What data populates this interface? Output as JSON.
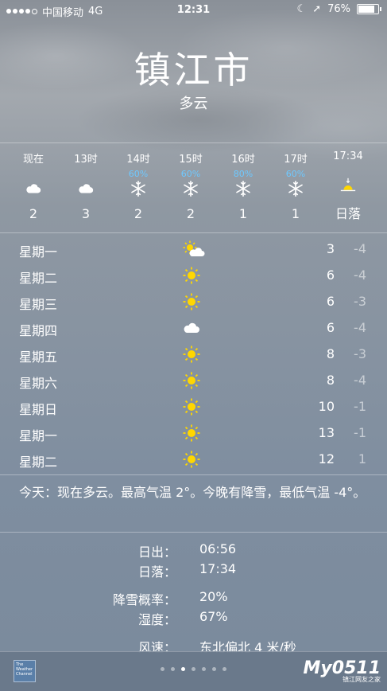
{
  "status_bar": {
    "carrier": "中国移动",
    "network": "4G",
    "time": "12:31",
    "battery": "76%"
  },
  "header": {
    "city": "镇江市",
    "condition": "多云"
  },
  "hourly": [
    {
      "label": "现在",
      "precip": "",
      "icon": "cloud-icon",
      "value": "2"
    },
    {
      "label": "13时",
      "precip": "",
      "icon": "cloud-icon",
      "value": "3"
    },
    {
      "label": "14时",
      "precip": "60%",
      "icon": "snowflake-icon",
      "value": "2"
    },
    {
      "label": "15时",
      "precip": "60%",
      "icon": "snowflake-icon",
      "value": "2"
    },
    {
      "label": "16时",
      "precip": "80%",
      "icon": "snowflake-icon",
      "value": "1"
    },
    {
      "label": "17时",
      "precip": "60%",
      "icon": "snowflake-icon",
      "value": "1"
    },
    {
      "label": "17:34",
      "precip": "",
      "icon": "sunset-icon",
      "value": "日落"
    }
  ],
  "daily": [
    {
      "day": "星期一",
      "icon": "partly-sunny-icon",
      "high": "3",
      "low": "-4"
    },
    {
      "day": "星期二",
      "icon": "sun-icon",
      "high": "6",
      "low": "-4"
    },
    {
      "day": "星期三",
      "icon": "sun-icon",
      "high": "6",
      "low": "-3"
    },
    {
      "day": "星期四",
      "icon": "cloud-icon",
      "high": "6",
      "low": "-4"
    },
    {
      "day": "星期五",
      "icon": "sun-icon",
      "high": "8",
      "low": "-3"
    },
    {
      "day": "星期六",
      "icon": "sun-icon",
      "high": "8",
      "low": "-4"
    },
    {
      "day": "星期日",
      "icon": "sun-icon",
      "high": "10",
      "low": "-1"
    },
    {
      "day": "星期一",
      "icon": "sun-icon",
      "high": "13",
      "low": "-1"
    },
    {
      "day": "星期二",
      "icon": "sun-icon",
      "high": "12",
      "low": "1"
    }
  ],
  "summary": "今天：现在多云。最高气温 2°。今晚有降雪，最低气温 -4°。",
  "details": [
    {
      "label": "日出：",
      "value": "06:56"
    },
    {
      "label": "日落：",
      "value": "17:34"
    },
    {
      "label": "降雪概率：",
      "value": "20%"
    },
    {
      "label": "湿度：",
      "value": "67%"
    },
    {
      "label": "风速：",
      "value": "东北偏北 4 米/秒"
    }
  ],
  "footer": {
    "logo_text": "The Weather Channel",
    "page_count": 7,
    "active_page": 3,
    "watermark": "My0511",
    "watermark_sub": "镇江网友之家"
  },
  "colors": {
    "precip": "#6ec8ff",
    "sun": "#ffd700"
  }
}
